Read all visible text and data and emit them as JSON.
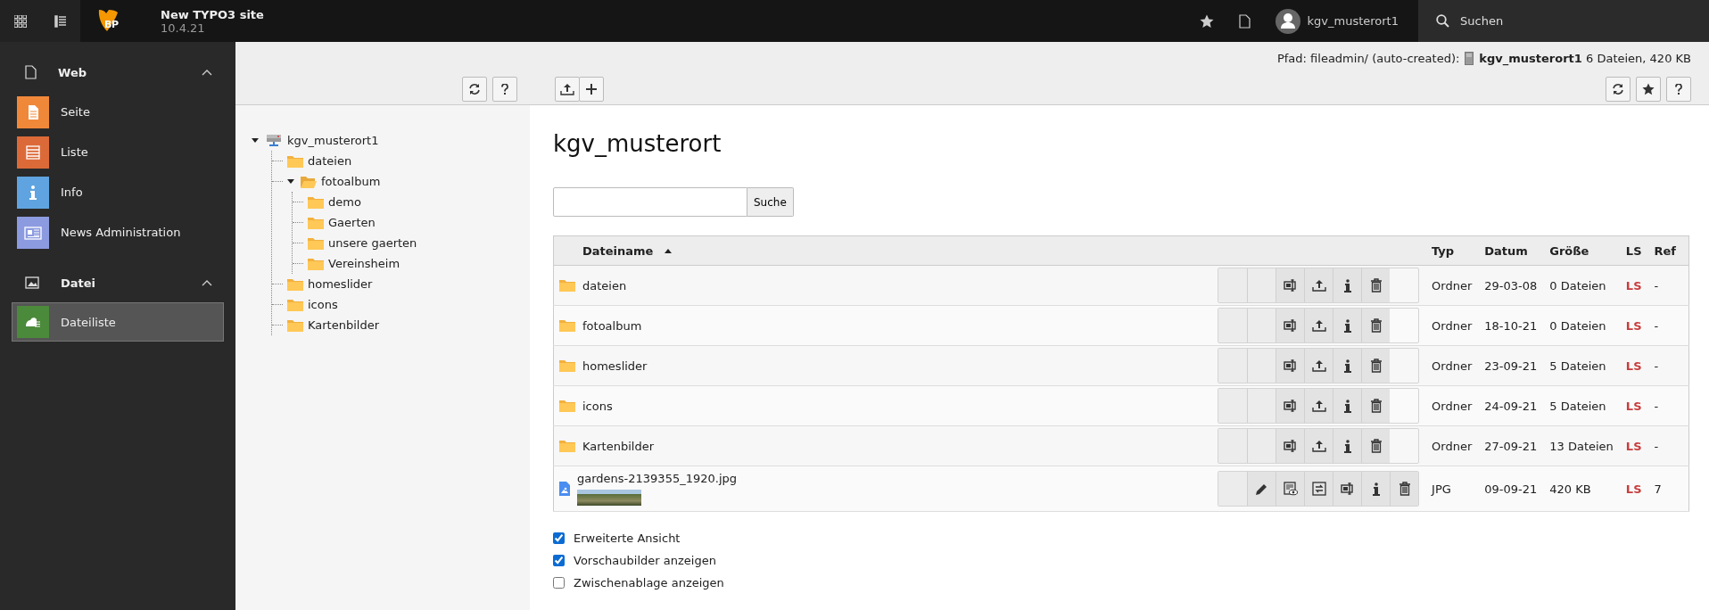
{
  "topbar": {
    "logo_text": "BP",
    "site_name": "New TYPO3 site",
    "version": "10.4.21",
    "user": "kgv_musterort1",
    "search_label": "Suchen"
  },
  "sidebar": {
    "groups": [
      {
        "label": "Web",
        "kind": "page",
        "expanded": true,
        "items": [
          {
            "label": "Seite",
            "kind": "page",
            "color": "#f0883a",
            "selected": false
          },
          {
            "label": "Liste",
            "kind": "list",
            "color": "#dc6a38",
            "selected": false
          },
          {
            "label": "Info",
            "kind": "info",
            "color": "#5fa4e0",
            "selected": false
          },
          {
            "label": "News Administration",
            "kind": "news",
            "color": "#8c9be0",
            "selected": false
          }
        ]
      },
      {
        "label": "Datei",
        "kind": "image",
        "expanded": true,
        "items": [
          {
            "label": "Dateiliste",
            "kind": "files",
            "color": "#4b8a3a",
            "selected": true
          }
        ]
      }
    ]
  },
  "docheader": {
    "path_label": "Pfad: fileadmin/ (auto-created):",
    "path_value": "**kgv_musterort1** 6 Dateien, 420 KB"
  },
  "tree": {
    "label": "kgv_musterort1",
    "expanded": true,
    "children": [
      {
        "label": "dateien"
      },
      {
        "label": "fotoalbum",
        "expanded": true,
        "children": [
          {
            "label": "demo"
          },
          {
            "label": "Gaerten"
          },
          {
            "label": "unsere gaerten"
          },
          {
            "label": "Vereinsheim"
          }
        ]
      },
      {
        "label": "homeslider"
      },
      {
        "label": "icons"
      },
      {
        "label": "Kartenbilder"
      }
    ]
  },
  "main": {
    "title": "kgv_musterort",
    "search_button": "Suche",
    "columns": [
      {
        "label": "Dateiname",
        "sorted": true
      },
      {
        "label": "Typ",
        "sorted": false
      },
      {
        "label": "Datum",
        "sorted": false
      },
      {
        "label": "Größe",
        "sorted": false
      },
      {
        "label": "LS",
        "sorted": false
      },
      {
        "label": "Ref",
        "sorted": false
      }
    ],
    "rows": [
      {
        "kind": "folder",
        "name": "dateien",
        "type": "Ordner",
        "date": "29-03-08",
        "size": "0 Dateien",
        "ls": "LS",
        "ref": "-"
      },
      {
        "kind": "folder",
        "name": "fotoalbum",
        "type": "Ordner",
        "date": "18-10-21",
        "size": "0 Dateien",
        "ls": "LS",
        "ref": "-"
      },
      {
        "kind": "folder",
        "name": "homeslider",
        "type": "Ordner",
        "date": "23-09-21",
        "size": "5 Dateien",
        "ls": "LS",
        "ref": "-"
      },
      {
        "kind": "folder",
        "name": "icons",
        "type": "Ordner",
        "date": "24-09-21",
        "size": "5 Dateien",
        "ls": "LS",
        "ref": "-"
      },
      {
        "kind": "folder",
        "name": "Kartenbilder",
        "type": "Ordner",
        "date": "27-09-21",
        "size": "13 Dateien",
        "ls": "LS",
        "ref": "-"
      },
      {
        "kind": "file",
        "name": "gardens-2139355_1920.jpg",
        "type": "JPG",
        "date": "09-09-21",
        "size": "420 KB",
        "ls": "LS",
        "ref": "7",
        "thumbnail": true
      }
    ],
    "options": [
      {
        "label": "Erweiterte Ansicht",
        "checked": true
      },
      {
        "label": "Vorschaubilder anzeigen",
        "checked": true
      },
      {
        "label": "Zwischenablage anzeigen",
        "checked": false
      }
    ]
  }
}
